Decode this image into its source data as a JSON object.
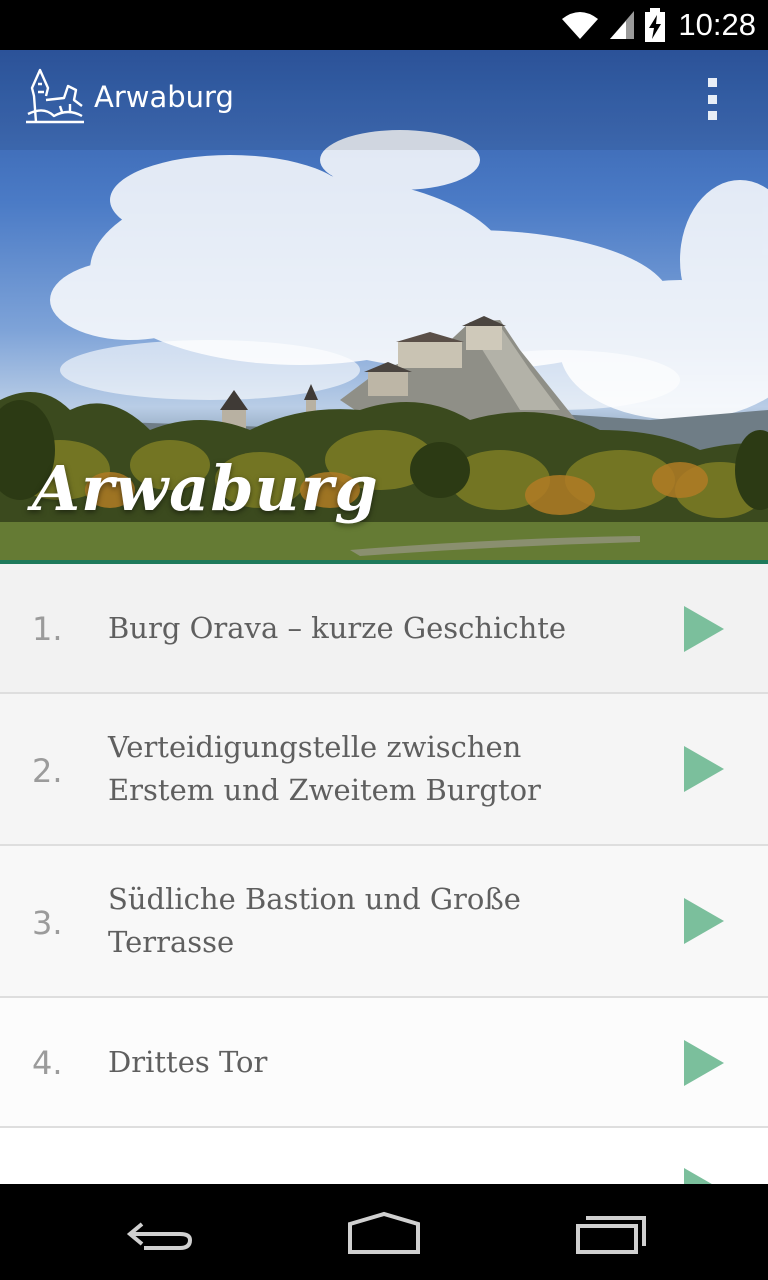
{
  "status_bar": {
    "time": "10:28",
    "icons": [
      "wifi-icon",
      "signal-icon",
      "battery-charging-icon"
    ]
  },
  "app_bar": {
    "title": "Arwaburg",
    "logo": "castle-logo-icon",
    "menu_icon": "overflow-menu-icon"
  },
  "hero": {
    "title": "Arwaburg"
  },
  "list": {
    "items": [
      {
        "number": "1.",
        "title": "Burg Orava – kurze Geschichte"
      },
      {
        "number": "2.",
        "title": "Verteidigungstelle zwischen Erstem und Zweitem Burgtor"
      },
      {
        "number": "3.",
        "title": "Südliche Bastion und Große Terrasse"
      },
      {
        "number": "4.",
        "title": "Drittes Tor"
      }
    ]
  },
  "navigation": {
    "icons": [
      "back-icon",
      "home-icon",
      "recent-apps-icon"
    ]
  },
  "colors": {
    "accent": "#1e7a5b",
    "play": "#7bbf9c",
    "list_bg": "#f4f4f4"
  }
}
